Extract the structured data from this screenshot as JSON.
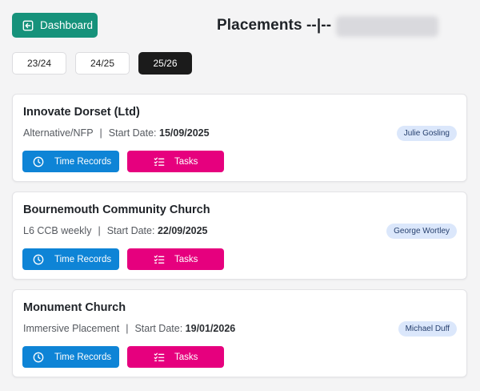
{
  "header": {
    "dashboard_label": "Dashboard",
    "title": "Placements --|--"
  },
  "year_tabs": [
    {
      "label": "23/24",
      "active": false
    },
    {
      "label": "24/25",
      "active": false
    },
    {
      "label": "25/26",
      "active": true
    }
  ],
  "placements": [
    {
      "name": "Innovate Dorset (Ltd)",
      "type": "Alternative/NFP",
      "start_label": "Start Date:",
      "start_date": "15/09/2025",
      "contact": "Julie Gosling",
      "time_label": "Time Records",
      "tasks_label": "Tasks"
    },
    {
      "name": "Bournemouth Community Church",
      "type": "L6 CCB weekly",
      "start_label": "Start Date:",
      "start_date": "22/09/2025",
      "contact": "George Wortley",
      "time_label": "Time Records",
      "tasks_label": "Tasks"
    },
    {
      "name": "Monument Church",
      "type": "Immersive Placement",
      "start_label": "Start Date:",
      "start_date": "19/01/2026",
      "contact": "Michael Duff",
      "time_label": "Time Records",
      "tasks_label": "Tasks"
    }
  ],
  "colors": {
    "dashboard_button": "#16927b",
    "time_button": "#0e84d6",
    "tasks_button": "#e6007e",
    "active_tab": "#1b1b1b",
    "badge_bg": "#dbe7fb"
  },
  "icons": {
    "dashboard": "arrow-left-box-icon",
    "time_records": "clock-icon",
    "tasks": "checklist-icon"
  }
}
